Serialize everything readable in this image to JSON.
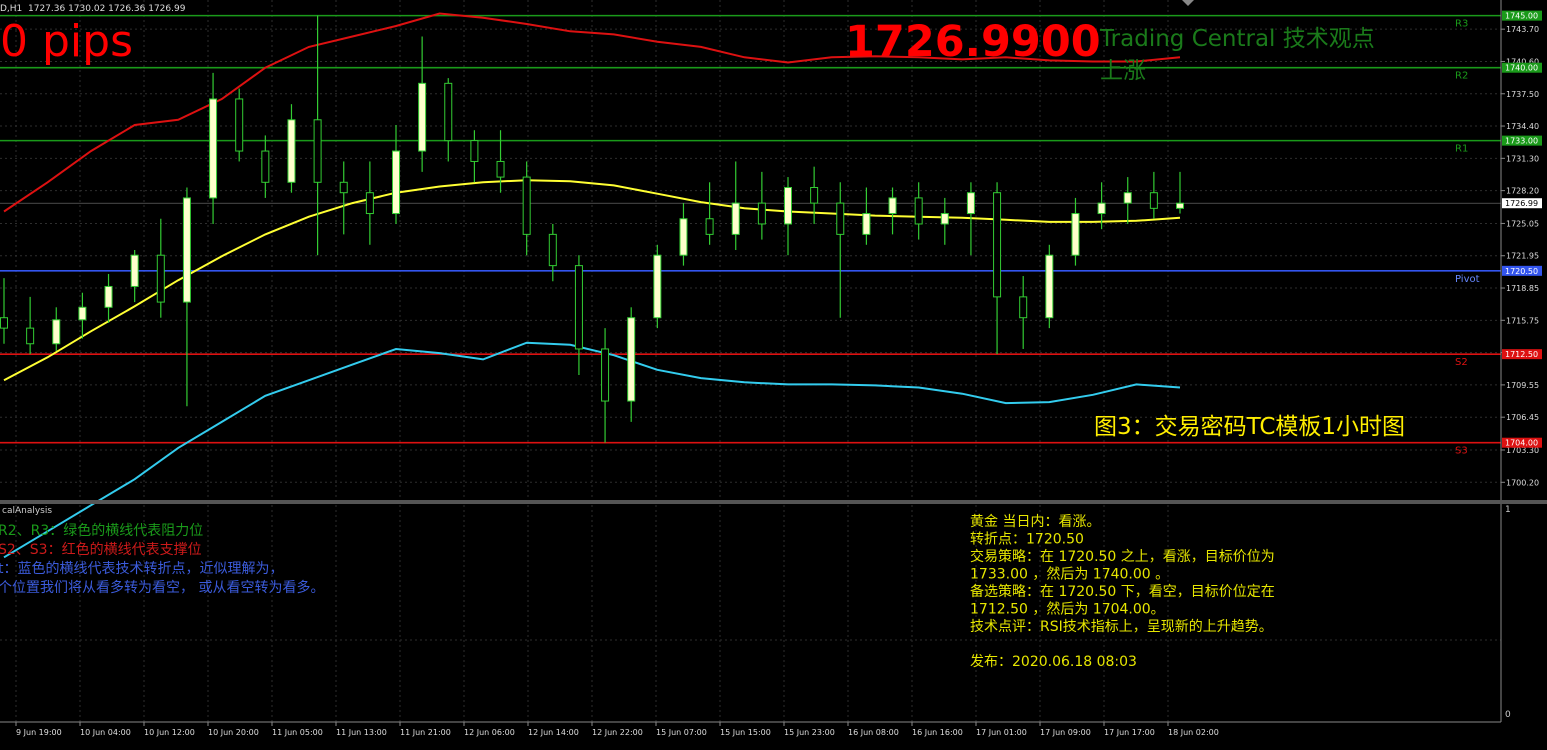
{
  "window": {
    "symbol_caption": "D,H1",
    "ohlc_caption": "1727.36 1730.02 1726.36 1726.99",
    "pips_text": "0 pips",
    "big_price": "1726.9900",
    "tc_title": "Trading Central 技术观点",
    "tc_trend": "上涨",
    "figure_caption": "图3：交易密码TC模板1小时图",
    "subwindow_title": "calAnalysis",
    "subwindow_scale_top": "1",
    "subwindow_scale_bottom": "0"
  },
  "legend_lines": [
    {
      "text": "R2、R3：绿色的横线代表阻力位",
      "color": "#1a9a1a"
    },
    {
      "text": "S2、S3：红色的横线代表支撑位",
      "color": "#cc1a1a"
    },
    {
      "text": "t：蓝色的横线代表技术转折点，近似理解为，",
      "color": "#3b5bdb"
    },
    {
      "text": "个位置我们将从看多转为看空，  或从看空转为看多。",
      "color": "#3b5bdb"
    }
  ],
  "analysis_lines": [
    "黄金 当日内：看涨。",
    "转折点：1720.50",
    "交易策略：在 1720.50 之上，看涨，目标价位为",
    "1733.00 ，然后为 1740.00 。",
    "备选策略：在 1720.50 下，看空，目标价位定在",
    "1712.50 ，然后为 1704.00。",
    "技术点评：RSI技术指标上，呈现新的上升趋势。",
    "",
    "发布：2020.06.18 08:03"
  ],
  "colors": {
    "background": "#000000",
    "grid": "#2e2e2e",
    "candle_bull": "#ffffcc",
    "candle_bear": "#000000",
    "candle_wick": "#33cc33",
    "resistance": "#1a9a1a",
    "support": "#dd1111",
    "pivot": "#3355ee",
    "ma_yellow": "#ffff33",
    "band_red": "#dd1111",
    "band_cyan": "#33ccee",
    "big_price": "#ff0000",
    "tc_text": "#1a7a1a",
    "caption": "#ffee00",
    "analysis_text": "#e6e600"
  },
  "chart_data": {
    "type": "candlestick",
    "y_range": [
      1698.5,
      1746.5
    ],
    "y_ticks": [
      "1743.70",
      "1740.60",
      "1737.50",
      "1734.40",
      "1731.30",
      "1728.20",
      "1725.05",
      "1721.95",
      "1718.85",
      "1715.75",
      "1712.65",
      "1709.55",
      "1706.45",
      "1703.30",
      "1700.20"
    ],
    "x_tick_labels": [
      "9 Jun 19:00",
      "10 Jun 04:00",
      "10 Jun 12:00",
      "10 Jun 20:00",
      "11 Jun 05:00",
      "11 Jun 13:00",
      "11 Jun 21:00",
      "12 Jun 06:00",
      "12 Jun 14:00",
      "12 Jun 22:00",
      "15 Jun 07:00",
      "15 Jun 15:00",
      "15 Jun 23:00",
      "16 Jun 08:00",
      "16 Jun 16:00",
      "17 Jun 01:00",
      "17 Jun 09:00",
      "17 Jun 17:00",
      "18 Jun 02:00"
    ],
    "current_price": {
      "value": 1726.99,
      "label": "1726.99"
    },
    "levels": [
      {
        "name": "R3",
        "value": 1745.0,
        "label": "1745.00",
        "kind": "resistance"
      },
      {
        "name": "R2",
        "value": 1740.0,
        "label": "1740.00",
        "kind": "resistance"
      },
      {
        "name": "R1",
        "value": 1733.0,
        "label": "1733.00",
        "kind": "resistance"
      },
      {
        "name": "Pivot",
        "value": 1720.5,
        "label": "1720.50",
        "kind": "pivot"
      },
      {
        "name": "S2",
        "value": 1712.5,
        "label": "1712.50",
        "kind": "support"
      },
      {
        "name": "S3",
        "value": 1704.0,
        "label": "1704.00",
        "kind": "support"
      }
    ],
    "ma_yellow": [
      1710.0,
      1712.2,
      1714.7,
      1717.1,
      1719.6,
      1721.9,
      1724.0,
      1725.7,
      1727.0,
      1728.0,
      1728.6,
      1729.0,
      1729.2,
      1729.1,
      1728.7,
      1727.9,
      1727.1,
      1726.5,
      1726.2,
      1726.0,
      1725.8,
      1725.7,
      1725.6,
      1725.4,
      1725.2,
      1725.2,
      1725.3,
      1725.6
    ],
    "band_red": [
      1726.2,
      1729.0,
      1732.0,
      1734.5,
      1735.0,
      1737.0,
      1740.0,
      1742.0,
      1743.0,
      1744.0,
      1745.2,
      1744.8,
      1744.2,
      1743.5,
      1743.2,
      1742.5,
      1742.0,
      1741.0,
      1740.5,
      1741.0,
      1741.1,
      1741.0,
      1740.8,
      1741.0,
      1740.7,
      1740.6,
      1740.6,
      1741.0
    ],
    "band_cyan": [
      1693.0,
      1695.5,
      1698.0,
      1700.5,
      1703.5,
      1706.0,
      1708.5,
      1710.0,
      1711.5,
      1713.0,
      1712.6,
      1712.0,
      1713.6,
      1713.4,
      1712.4,
      1711.0,
      1710.2,
      1709.8,
      1709.6,
      1709.6,
      1709.5,
      1709.3,
      1708.7,
      1707.8,
      1707.9,
      1708.6,
      1709.6,
      1709.3
    ],
    "candles": [
      {
        "o": 1716.0,
        "h": 1719.8,
        "l": 1713.5,
        "c": 1715.0
      },
      {
        "o": 1715.0,
        "h": 1718.0,
        "l": 1712.5,
        "c": 1713.5
      },
      {
        "o": 1713.5,
        "h": 1717.0,
        "l": 1712.8,
        "c": 1715.8
      },
      {
        "o": 1715.8,
        "h": 1718.4,
        "l": 1714.0,
        "c": 1717.0
      },
      {
        "o": 1717.0,
        "h": 1720.2,
        "l": 1715.5,
        "c": 1719.0
      },
      {
        "o": 1719.0,
        "h": 1722.5,
        "l": 1717.5,
        "c": 1722.0
      },
      {
        "o": 1722.0,
        "h": 1725.5,
        "l": 1716.0,
        "c": 1717.5
      },
      {
        "o": 1717.5,
        "h": 1728.5,
        "l": 1707.5,
        "c": 1727.5
      },
      {
        "o": 1727.5,
        "h": 1739.5,
        "l": 1725.0,
        "c": 1737.0
      },
      {
        "o": 1737.0,
        "h": 1738.0,
        "l": 1731.0,
        "c": 1732.0
      },
      {
        "o": 1732.0,
        "h": 1733.5,
        "l": 1727.5,
        "c": 1729.0
      },
      {
        "o": 1729.0,
        "h": 1736.5,
        "l": 1728.0,
        "c": 1735.0
      },
      {
        "o": 1735.0,
        "h": 1745.0,
        "l": 1722.0,
        "c": 1729.0
      },
      {
        "o": 1729.0,
        "h": 1731.0,
        "l": 1724.0,
        "c": 1728.0
      },
      {
        "o": 1728.0,
        "h": 1731.0,
        "l": 1723.0,
        "c": 1726.0
      },
      {
        "o": 1726.0,
        "h": 1734.5,
        "l": 1725.0,
        "c": 1732.0
      },
      {
        "o": 1732.0,
        "h": 1743.0,
        "l": 1730.0,
        "c": 1738.5
      },
      {
        "o": 1738.5,
        "h": 1739.0,
        "l": 1731.0,
        "c": 1733.0
      },
      {
        "o": 1733.0,
        "h": 1734.0,
        "l": 1729.0,
        "c": 1731.0
      },
      {
        "o": 1731.0,
        "h": 1734.0,
        "l": 1728.0,
        "c": 1729.5
      },
      {
        "o": 1729.5,
        "h": 1731.0,
        "l": 1722.0,
        "c": 1724.0
      },
      {
        "o": 1724.0,
        "h": 1725.0,
        "l": 1719.5,
        "c": 1721.0
      },
      {
        "o": 1721.0,
        "h": 1722.0,
        "l": 1710.5,
        "c": 1713.0
      },
      {
        "o": 1713.0,
        "h": 1715.0,
        "l": 1704.0,
        "c": 1708.0
      },
      {
        "o": 1708.0,
        "h": 1717.0,
        "l": 1706.0,
        "c": 1716.0
      },
      {
        "o": 1716.0,
        "h": 1723.0,
        "l": 1715.0,
        "c": 1722.0
      },
      {
        "o": 1722.0,
        "h": 1727.0,
        "l": 1721.0,
        "c": 1725.5
      },
      {
        "o": 1725.5,
        "h": 1729.0,
        "l": 1723.0,
        "c": 1724.0
      },
      {
        "o": 1724.0,
        "h": 1731.0,
        "l": 1722.5,
        "c": 1727.0
      },
      {
        "o": 1727.0,
        "h": 1730.0,
        "l": 1723.5,
        "c": 1725.0
      },
      {
        "o": 1725.0,
        "h": 1729.5,
        "l": 1722.0,
        "c": 1728.5
      },
      {
        "o": 1728.5,
        "h": 1730.5,
        "l": 1725.0,
        "c": 1727.0
      },
      {
        "o": 1727.0,
        "h": 1729.0,
        "l": 1716.0,
        "c": 1724.0
      },
      {
        "o": 1724.0,
        "h": 1728.5,
        "l": 1723.0,
        "c": 1726.0
      },
      {
        "o": 1726.0,
        "h": 1728.5,
        "l": 1724.0,
        "c": 1727.5
      },
      {
        "o": 1727.5,
        "h": 1729.0,
        "l": 1723.5,
        "c": 1725.0
      },
      {
        "o": 1725.0,
        "h": 1727.5,
        "l": 1723.0,
        "c": 1726.0
      },
      {
        "o": 1726.0,
        "h": 1729.0,
        "l": 1722.0,
        "c": 1728.0
      },
      {
        "o": 1728.0,
        "h": 1729.0,
        "l": 1712.5,
        "c": 1718.0
      },
      {
        "o": 1718.0,
        "h": 1720.0,
        "l": 1713.0,
        "c": 1716.0
      },
      {
        "o": 1716.0,
        "h": 1723.0,
        "l": 1715.0,
        "c": 1722.0
      },
      {
        "o": 1722.0,
        "h": 1727.5,
        "l": 1721.0,
        "c": 1726.0
      },
      {
        "o": 1726.0,
        "h": 1729.0,
        "l": 1724.5,
        "c": 1727.0
      },
      {
        "o": 1727.0,
        "h": 1729.5,
        "l": 1725.0,
        "c": 1728.0
      },
      {
        "o": 1728.0,
        "h": 1730.0,
        "l": 1725.5,
        "c": 1726.5
      },
      {
        "o": 1726.5,
        "h": 1730.0,
        "l": 1726.0,
        "c": 1726.99
      }
    ]
  }
}
